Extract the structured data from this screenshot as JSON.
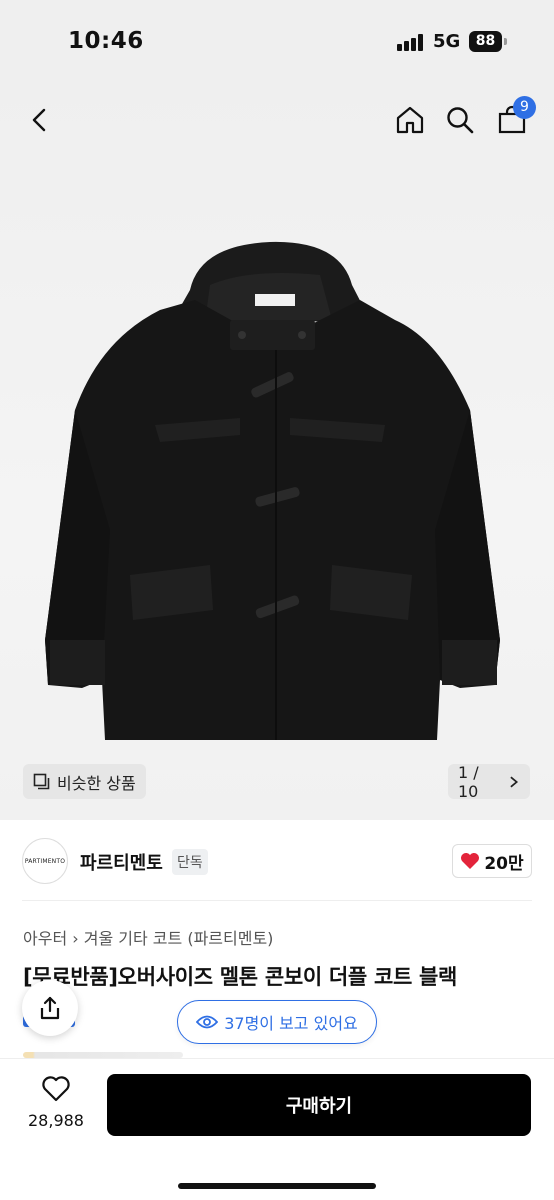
{
  "status_bar": {
    "time": "10:46",
    "network": "5G",
    "battery": "88"
  },
  "header": {
    "cart_count": "9"
  },
  "hero": {
    "similar_label": "비슷한 상품",
    "page_indicator": "1 / 10"
  },
  "seller": {
    "logo_text": "PARTIMENTO",
    "name": "파르티멘토",
    "tag": "단독",
    "likes": "20만"
  },
  "product": {
    "breadcrumb": [
      "아우터",
      "겨울 기타 코트 (파르티멘토)"
    ],
    "title": "[무료반품]오버사이즈 멜톤 콘보이 더플 코트 블랙"
  },
  "viewers": {
    "label": "37명이 보고 있어요"
  },
  "bottom": {
    "wish_count": "28,988",
    "buy_label": "구매하기"
  },
  "colors": {
    "accent": "#2f6fe4",
    "like": "#e3243b",
    "primary_button": "#000000"
  }
}
